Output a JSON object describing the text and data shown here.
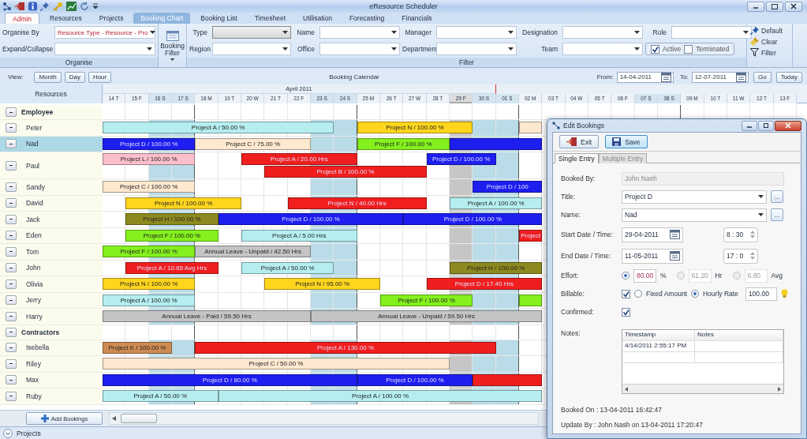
{
  "window": {
    "title": "eResource Scheduler"
  },
  "tabs": [
    {
      "label": "Admin",
      "kind": "app",
      "selected": false
    },
    {
      "label": "Resources",
      "kind": "tab",
      "selected": false
    },
    {
      "label": "Projects",
      "kind": "tab",
      "selected": false
    },
    {
      "label": "Booking Chart",
      "kind": "tab",
      "selected": true
    },
    {
      "label": "Booking List",
      "kind": "tab",
      "selected": false
    },
    {
      "label": "Timesheet",
      "kind": "tab",
      "selected": false
    },
    {
      "label": "Utilisation",
      "kind": "tab",
      "selected": false
    },
    {
      "label": "Forecasting",
      "kind": "tab",
      "selected": false
    },
    {
      "label": "Financials",
      "kind": "tab",
      "selected": false
    }
  ],
  "organise": {
    "title": "Organise",
    "fields": [
      {
        "label": "Organise By",
        "value": "Resource Type - Resource - Pro"
      },
      {
        "label": "Expand/Collapse"
      }
    ]
  },
  "booking_filter": {
    "label": "Booking Filter"
  },
  "filter": {
    "title": "Filter",
    "fields": [
      {
        "label": "Type",
        "disabled": true
      },
      {
        "label": "Name",
        "disabled": false
      },
      {
        "label": "Manager",
        "disabled": false
      },
      {
        "label": "Designation",
        "disabled": false
      },
      {
        "label": "Role",
        "disabled": false
      },
      {
        "label": "Region",
        "disabled": false
      },
      {
        "label": "Office",
        "disabled": false
      },
      {
        "label": "Department",
        "disabled": false
      },
      {
        "label": "Team",
        "disabled": false
      }
    ],
    "status": [
      {
        "label": "Active",
        "checked": true
      },
      {
        "label": "Terminated",
        "checked": false
      }
    ]
  },
  "actions": [
    {
      "label": "Default",
      "kind": "pin"
    },
    {
      "label": "Clear",
      "kind": "brush"
    },
    {
      "label": "Filter",
      "kind": "funnel"
    }
  ],
  "view": {
    "label": "View:",
    "modes": [
      "Month",
      "Day",
      "Hour"
    ],
    "title": "Booking Calendar",
    "from": {
      "label": "From:",
      "value": "14-04-2011"
    },
    "to": {
      "label": "To:",
      "value": "12-07-2011"
    },
    "buttons": [
      "Go",
      "Today"
    ]
  },
  "chart": {
    "resources_header": "Resources",
    "month": "April 2011",
    "days": [
      {
        "label": "14 T",
        "weekend": false,
        "holiday": false
      },
      {
        "label": "15 F",
        "weekend": false,
        "holiday": false
      },
      {
        "label": "16 S",
        "weekend": true,
        "holiday": false
      },
      {
        "label": "17 S",
        "weekend": true,
        "holiday": false
      },
      {
        "label": "18 M",
        "weekend": false,
        "holiday": false
      },
      {
        "label": "19 T",
        "weekend": false,
        "holiday": false
      },
      {
        "label": "20 W",
        "weekend": false,
        "holiday": false
      },
      {
        "label": "21 T",
        "weekend": false,
        "holiday": false
      },
      {
        "label": "22 F",
        "weekend": false,
        "holiday": false
      },
      {
        "label": "23 S",
        "weekend": true,
        "holiday": false
      },
      {
        "label": "24 S",
        "weekend": true,
        "holiday": false
      },
      {
        "label": "25 M",
        "weekend": false,
        "holiday": false
      },
      {
        "label": "26 T",
        "weekend": false,
        "holiday": false
      },
      {
        "label": "27 W",
        "weekend": false,
        "holiday": false
      },
      {
        "label": "28 T",
        "weekend": false,
        "holiday": false
      },
      {
        "label": "29 F",
        "weekend": false,
        "holiday": true
      },
      {
        "label": "30 S",
        "weekend": true,
        "holiday": false
      },
      {
        "label": "01 S",
        "weekend": true,
        "holiday": false
      },
      {
        "label": "02 M",
        "weekend": false,
        "holiday": false
      },
      {
        "label": "03 T",
        "weekend": false,
        "holiday": false
      },
      {
        "label": "04 W",
        "weekend": false,
        "holiday": false
      },
      {
        "label": "05 T",
        "weekend": false,
        "holiday": false
      },
      {
        "label": "06 F",
        "weekend": false,
        "holiday": false
      },
      {
        "label": "07 S",
        "weekend": true,
        "holiday": false
      },
      {
        "label": "08 S",
        "weekend": true,
        "holiday": false
      },
      {
        "label": "09 M",
        "weekend": false,
        "holiday": false
      },
      {
        "label": "10 T",
        "weekend": false,
        "holiday": false
      },
      {
        "label": "11 W",
        "weekend": false,
        "holiday": false
      },
      {
        "label": "12 T",
        "weekend": false,
        "holiday": false
      },
      {
        "label": "13 F",
        "weekend": false,
        "holiday": false
      }
    ],
    "rows": [
      {
        "kind": "group",
        "name": "Employee",
        "selected": false
      },
      {
        "kind": "resource",
        "name": "Peter",
        "selected": false,
        "lanes": [
          [
            {
              "label": "Project A / 50.00 %",
              "color": "#b6eef0"
            },
            {
              "label": "Project N / 100.00 %",
              "color": "#ffd51e"
            },
            {
              "color": "#fde8d0"
            }
          ]
        ]
      },
      {
        "kind": "resource",
        "name": "Nad",
        "selected": true,
        "lanes": [
          [
            {
              "label": "Project D / 100.00 %",
              "color": "#1e1ef0"
            },
            {
              "label": "Project C / 75.00 %",
              "color": "#fde8d0"
            },
            {
              "label": "Project F / 100.00 %",
              "color": "#84f01e"
            },
            {
              "color": "#1e1ef0"
            }
          ]
        ]
      },
      {
        "kind": "resource",
        "name": "Paul",
        "selected": false,
        "lanes": [
          [
            {
              "label": "Project L / 100.00 %",
              "color": "#fbbfcc"
            },
            {
              "label": "Project A / 20.00 Hrs",
              "color": "#f01e1e"
            },
            {
              "label": "Project D / 100.00 %",
              "color": "#1e1ef0"
            }
          ],
          [
            {
              "label": "Project B / 100.00 %",
              "color": "#f01e1e"
            }
          ]
        ]
      },
      {
        "kind": "resource",
        "name": "Sandy",
        "selected": false,
        "lanes": [
          [
            {
              "label": "Project C / 100.00 %",
              "color": "#fde8d0"
            },
            {
              "label": "Project D / 100",
              "color": "#1e1ef0"
            }
          ]
        ]
      },
      {
        "kind": "resource",
        "name": "David",
        "selected": false,
        "lanes": [
          [
            {
              "label": "Project N / 100.00 %",
              "color": "#ffd51e"
            },
            {
              "label": "Project N / 40.00 Hrs",
              "color": "#f01e1e"
            },
            {
              "label": "Project A / 100.00 %",
              "color": "#b6eef0"
            }
          ]
        ]
      },
      {
        "kind": "resource",
        "name": "Jack",
        "selected": false,
        "lanes": [
          [
            {
              "label": "Project H / 100.00 %",
              "color": "#8c8a1e"
            },
            {
              "label": "Project D / 100.00 %",
              "color": "#1e1ef0"
            },
            {
              "label": "Project D / 100.00 %",
              "color": "#1e1ef0"
            }
          ]
        ]
      },
      {
        "kind": "resource",
        "name": "Eden",
        "selected": false,
        "lanes": [
          [
            {
              "label": "Project F / 100.00 %",
              "color": "#84f01e"
            },
            {
              "label": "Project A / 5.00 Hrs",
              "color": "#b6eef0"
            },
            {
              "label": "Project",
              "color": "#f01e1e"
            }
          ]
        ]
      },
      {
        "kind": "resource",
        "name": "Tom",
        "selected": false,
        "lanes": [
          [
            {
              "label": "Project F / 100.00 %",
              "color": "#84f01e"
            },
            {
              "label": "Annual Leave - Unpaid / 42.50 Hrs",
              "color": "#c4c4c4"
            }
          ]
        ]
      },
      {
        "kind": "resource",
        "name": "John",
        "selected": false,
        "lanes": [
          [
            {
              "label": "Project A / 10.65 Avg Hrs",
              "color": "#f01e1e"
            },
            {
              "label": "Project A / 50.00 %",
              "color": "#b6eef0"
            },
            {
              "label": "Project H / 100.00 %",
              "color": "#8c8a1e"
            }
          ]
        ]
      },
      {
        "kind": "resource",
        "name": "Olivia",
        "selected": false,
        "lanes": [
          [
            {
              "label": "Project N / 100.00 %",
              "color": "#ffd51e"
            },
            {
              "label": "Project N / 95.00 %",
              "color": "#ffd51e"
            },
            {
              "label": "Project D / 17.40 Hrs",
              "color": "#f01e1e"
            }
          ]
        ]
      },
      {
        "kind": "resource",
        "name": "Jerry",
        "selected": false,
        "lanes": [
          [
            {
              "label": "Project A / 100.00 %",
              "color": "#b6eef0"
            },
            {
              "label": "Project F / 100.00 %",
              "color": "#84f01e"
            },
            {
              "color": "#84f01e"
            }
          ]
        ]
      },
      {
        "kind": "resource",
        "name": "Harry",
        "selected": false,
        "lanes": [
          [
            {
              "label": "Annual Leave - Paid / 59.50 Hrs",
              "color": "#c4c4c4"
            },
            {
              "label": "Annual Leave - Unpaid / 59.50 Hrs",
              "color": "#c4c4c4"
            }
          ]
        ]
      },
      {
        "kind": "group",
        "name": "Contractors",
        "selected": false
      },
      {
        "kind": "resource",
        "name": "Isebella",
        "selected": false,
        "lanes": [
          [
            {
              "label": "Project K / 100.00 %",
              "color": "#cd8a52"
            },
            {
              "label": "Project A / 130.00 %",
              "color": "#f01e1e"
            }
          ]
        ]
      },
      {
        "kind": "resource",
        "name": "Riley",
        "selected": false,
        "lanes": [
          [
            {
              "label": "Project C / 50.00 %",
              "color": "#fde8d0"
            }
          ]
        ]
      },
      {
        "kind": "resource",
        "name": "Max",
        "selected": false,
        "lanes": [
          [
            {
              "label": "Project D / 80.00 %",
              "color": "#1e1ef0"
            },
            {
              "label": "Project D / 100.00 %",
              "color": "#1e1ef0"
            },
            {
              "color": "#f01e1e"
            }
          ]
        ]
      },
      {
        "kind": "resource",
        "name": "Ruby",
        "selected": false,
        "lanes": [
          [
            {
              "label": "Project A / 50.00 %",
              "color": "#b6eef0"
            },
            {
              "label": "Project A / 100.00 %",
              "color": "#b6eef0"
            }
          ]
        ]
      }
    ]
  },
  "footer": {
    "add_button": "Add Bookings"
  },
  "projects_bar": {
    "label": "Projects"
  },
  "dialog": {
    "title": "Edit Bookings",
    "toolbar": [
      {
        "label": "Exit",
        "kind": "exit"
      },
      {
        "label": "Save",
        "kind": "save"
      }
    ],
    "tabs": [
      {
        "label": "Single Entry",
        "selected": true
      },
      {
        "label": "Multiple Entry",
        "selected": false
      }
    ],
    "booked_by": {
      "label": "Booked By:",
      "value": "John Nash"
    },
    "title_field": {
      "label": "Title:",
      "value": "Project D",
      "more": "..."
    },
    "name_field": {
      "label": "Name:",
      "value": "Nad",
      "more": "..."
    },
    "start": {
      "label": "Start Date / Time:",
      "date": "29-04-2011",
      "time": "8 : 30"
    },
    "end": {
      "label": "End Date / Time:",
      "date": "11-05-2011",
      "time": "17 : 0"
    },
    "effort": {
      "label": "Effort:",
      "options": [
        {
          "value": "80.00",
          "unit": "%",
          "selected": true,
          "disabled": false
        },
        {
          "value": "61.20",
          "unit": "Hr",
          "selected": false,
          "disabled": true
        },
        {
          "value": "6.80",
          "unit": "Avg",
          "selected": false,
          "disabled": true
        }
      ]
    },
    "billable": {
      "label": "Billable:",
      "checked": true,
      "options": [
        {
          "label": "Fixed Amount",
          "selected": false
        },
        {
          "label": "Hourly Rate",
          "selected": true
        }
      ],
      "rate": "100.00"
    },
    "confirmed": {
      "label": "Confirmed:",
      "checked": true
    },
    "notes": {
      "label": "Notes:",
      "columns": [
        "Timestamp",
        "Notes"
      ],
      "rows": [
        {
          "timestamp": "4/14/2011 2:55:17 PM"
        }
      ]
    },
    "booked_on": "Booked On : 13-04-2011 16:42:47",
    "updated_by": "Update By : John Nash on 13-04-2011 17:20:47"
  }
}
